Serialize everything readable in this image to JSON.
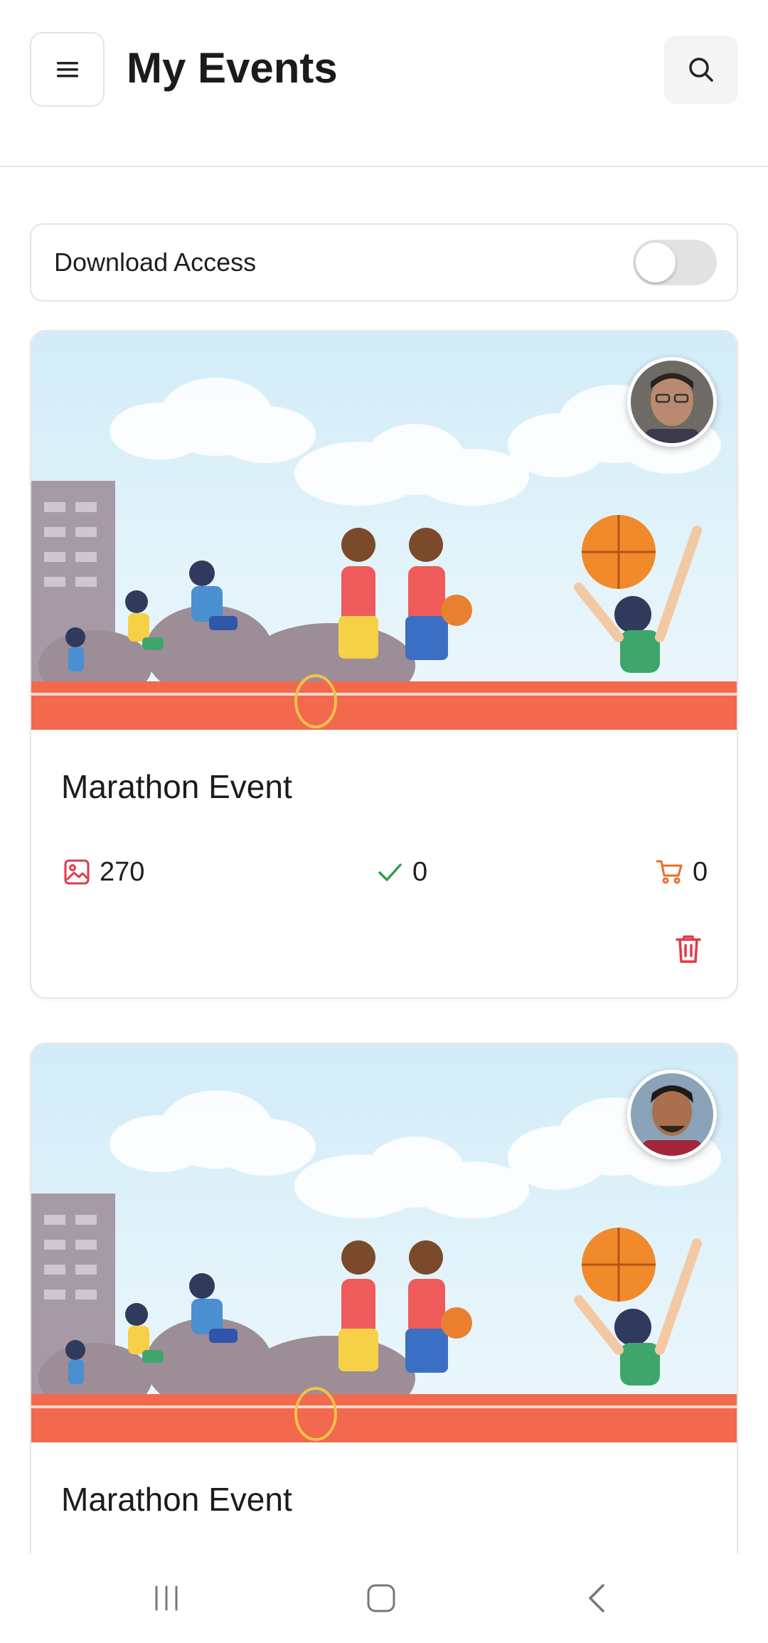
{
  "header": {
    "title": "My Events",
    "menu_icon": "hamburger-menu-icon",
    "search_icon": "search-icon"
  },
  "download_access": {
    "label": "Download Access",
    "enabled": false
  },
  "events": [
    {
      "title": "Marathon Event",
      "photos_count": "270",
      "approved_count": "0",
      "cart_count": "0"
    },
    {
      "title": "Marathon Event"
    }
  ],
  "colors": {
    "photo_icon": "#e03a4b",
    "check_icon": "#2e9e4f",
    "cart_icon": "#e8702a",
    "delete_icon": "#e03a4b",
    "track": "#f2694e",
    "sky": "#d6eef8"
  },
  "nav": {
    "recents_icon": "recents-icon",
    "home_icon": "home-icon",
    "back_icon": "back-icon"
  }
}
